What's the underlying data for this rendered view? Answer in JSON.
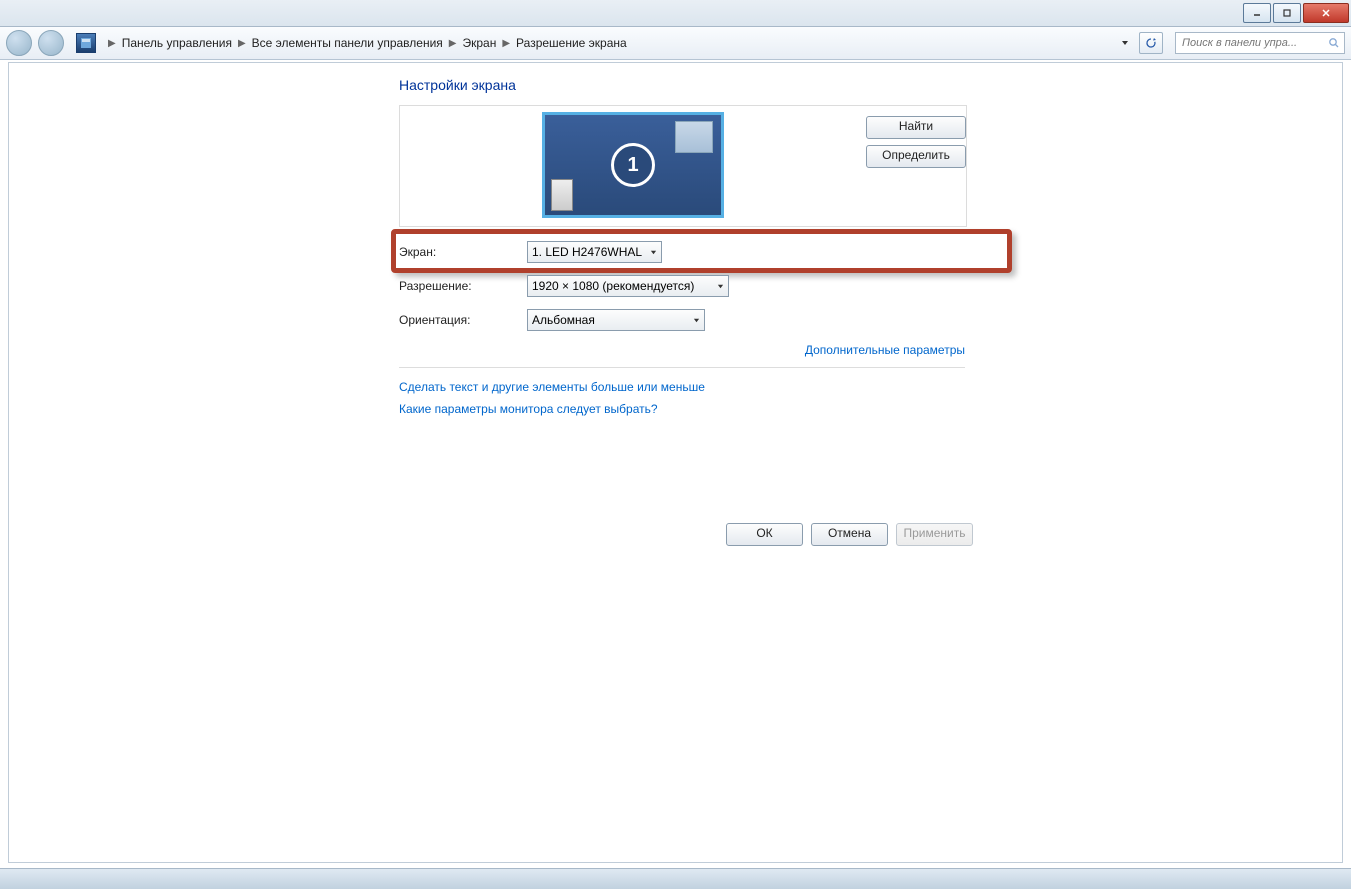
{
  "breadcrumb": {
    "items": [
      "Панель управления",
      "Все элементы панели управления",
      "Экран",
      "Разрешение экрана"
    ]
  },
  "search": {
    "placeholder": "Поиск в панели упра..."
  },
  "page": {
    "title": "Настройки экрана",
    "monitor_number": "1",
    "find_button": "Найти",
    "identify_button": "Определить",
    "screen_label": "Экран:",
    "screen_value": "1. LED H2476WHAL",
    "resolution_label": "Разрешение:",
    "resolution_value": "1920 × 1080 (рекомендуется)",
    "orientation_label": "Ориентация:",
    "orientation_value": "Альбомная",
    "advanced_link": "Дополнительные параметры",
    "text_size_link": "Сделать текст и другие элементы больше или меньше",
    "which_monitor_link": "Какие параметры монитора следует выбрать?"
  },
  "footer": {
    "ok": "ОК",
    "cancel": "Отмена",
    "apply": "Применить"
  }
}
